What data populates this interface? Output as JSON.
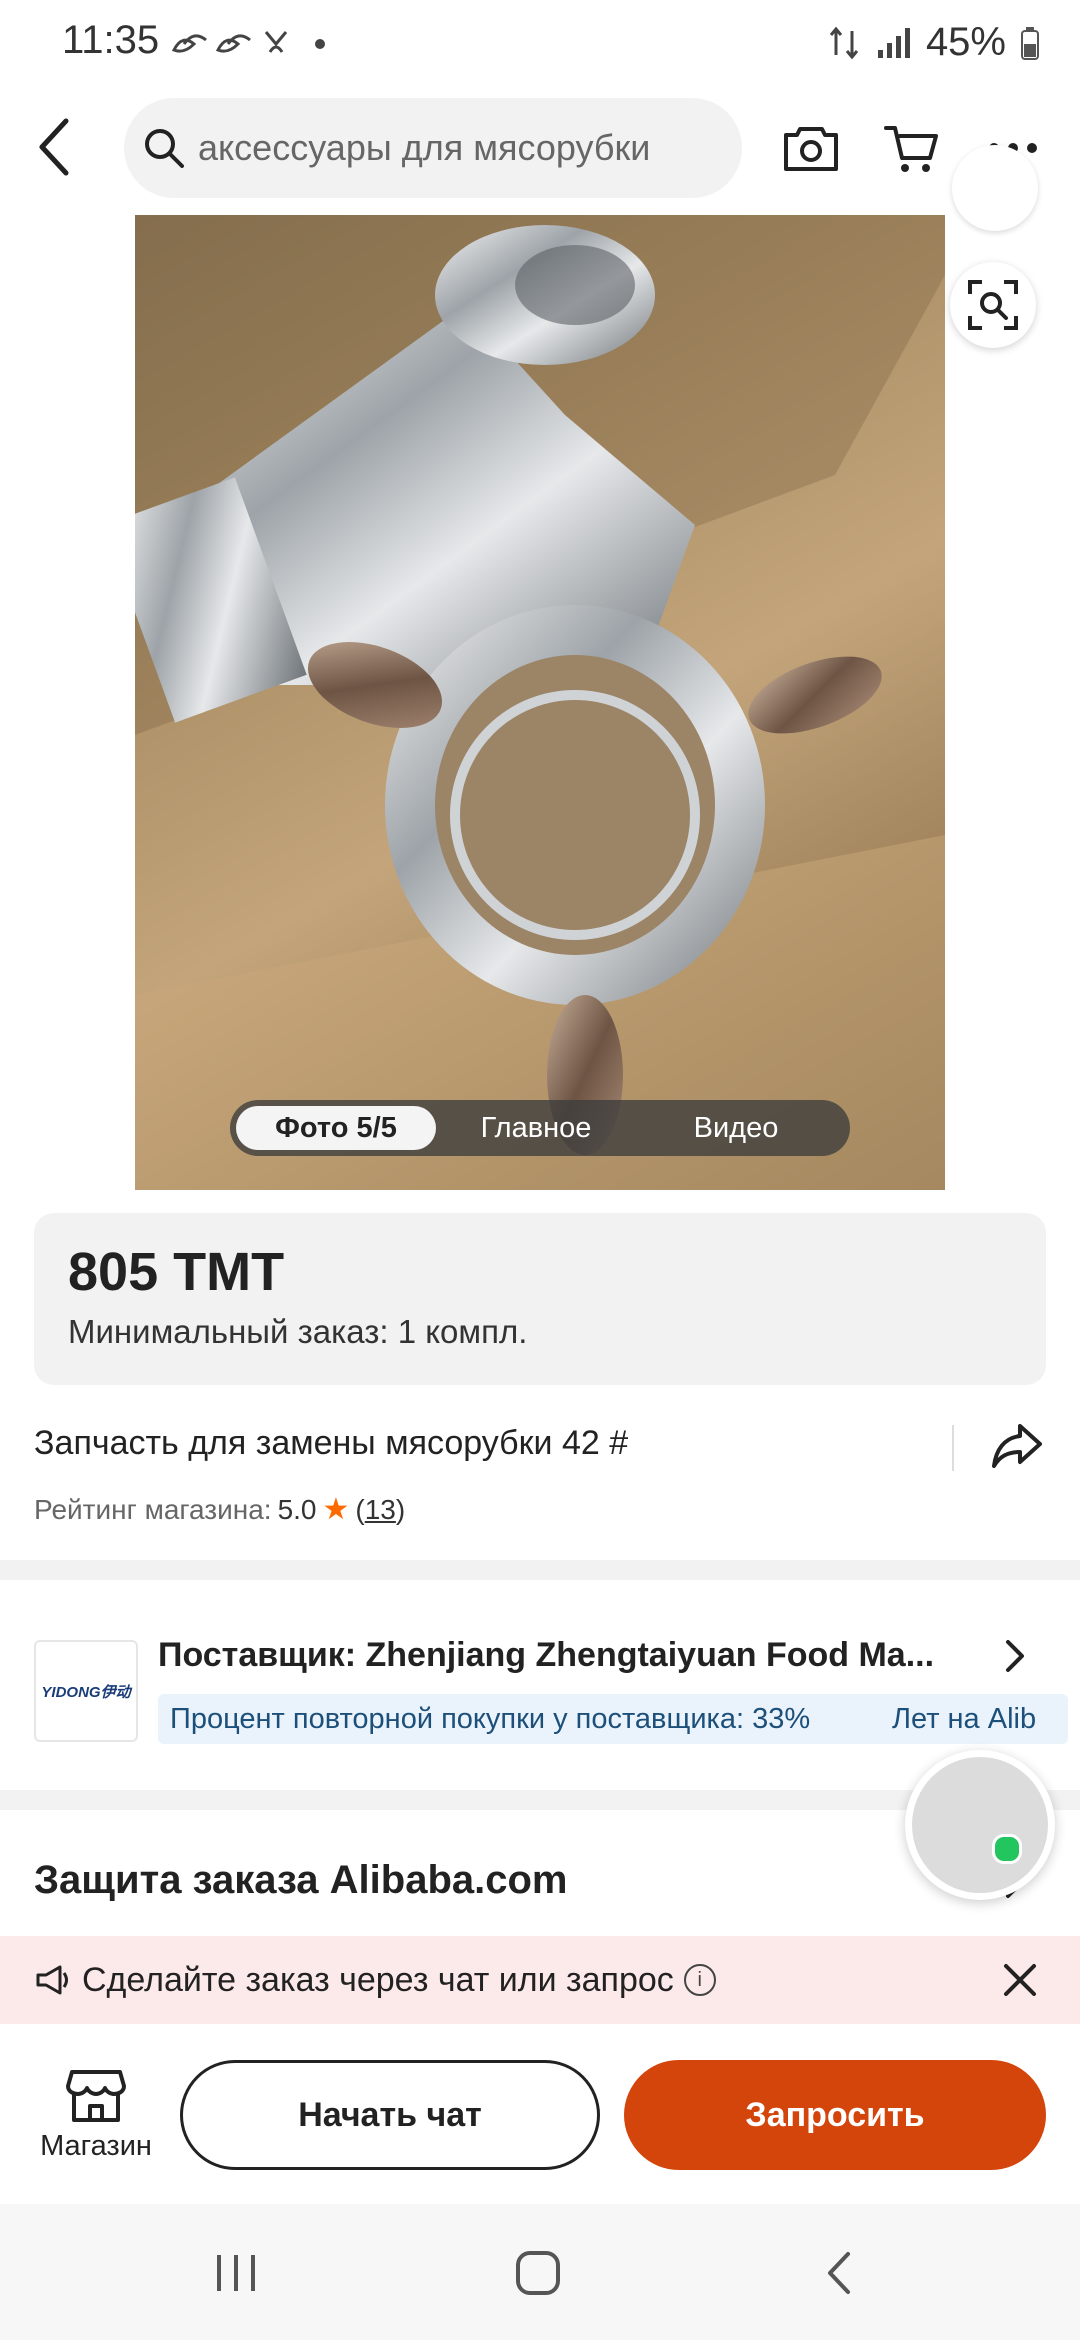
{
  "status_bar": {
    "time": "11:35",
    "notification_icons": [
      "signal-app-icon",
      "signal-app-icon",
      "missed-call-icon",
      "dot-icon"
    ],
    "battery": "45%"
  },
  "top_bar": {
    "search_text": "аксессуары для мясорубки",
    "icons": [
      "back-arrow-icon",
      "search-icon",
      "camera-icon",
      "cart-icon",
      "more-icon"
    ]
  },
  "gallery": {
    "tabs": [
      "Фото 5/5",
      "Главное",
      "Видео"
    ],
    "active_tab": 0
  },
  "product": {
    "price": "805 TMT",
    "moq": "Минимальный заказ: 1 компл.",
    "title": "Запчасть для замены мясорубки 42 #",
    "rating_label": "Рейтинг магазина:",
    "rating_value": "5.0",
    "rating_count": "13"
  },
  "supplier": {
    "logo_text": "YIDONG伊动",
    "name": "Поставщик: Zhenjiang Zhengtaiyuan Food Ma...",
    "tags": [
      "Процент повторной покупки у поставщика: 33%",
      "Лет на Alib"
    ]
  },
  "protection": {
    "title": "Защита заказа Alibaba.com"
  },
  "promo": {
    "text": "Сделайте заказ через чат или запрос"
  },
  "actions": {
    "store_label": "Магазин",
    "chat_label": "Начать чат",
    "request_label": "Запросить"
  },
  "colors": {
    "accent": "#d4450c",
    "star": "#ff6a00",
    "tag_bg": "#eaf3fb",
    "tag_text": "#1c4f7a",
    "promo_bg": "#fce9ea",
    "online": "#22c55e"
  }
}
